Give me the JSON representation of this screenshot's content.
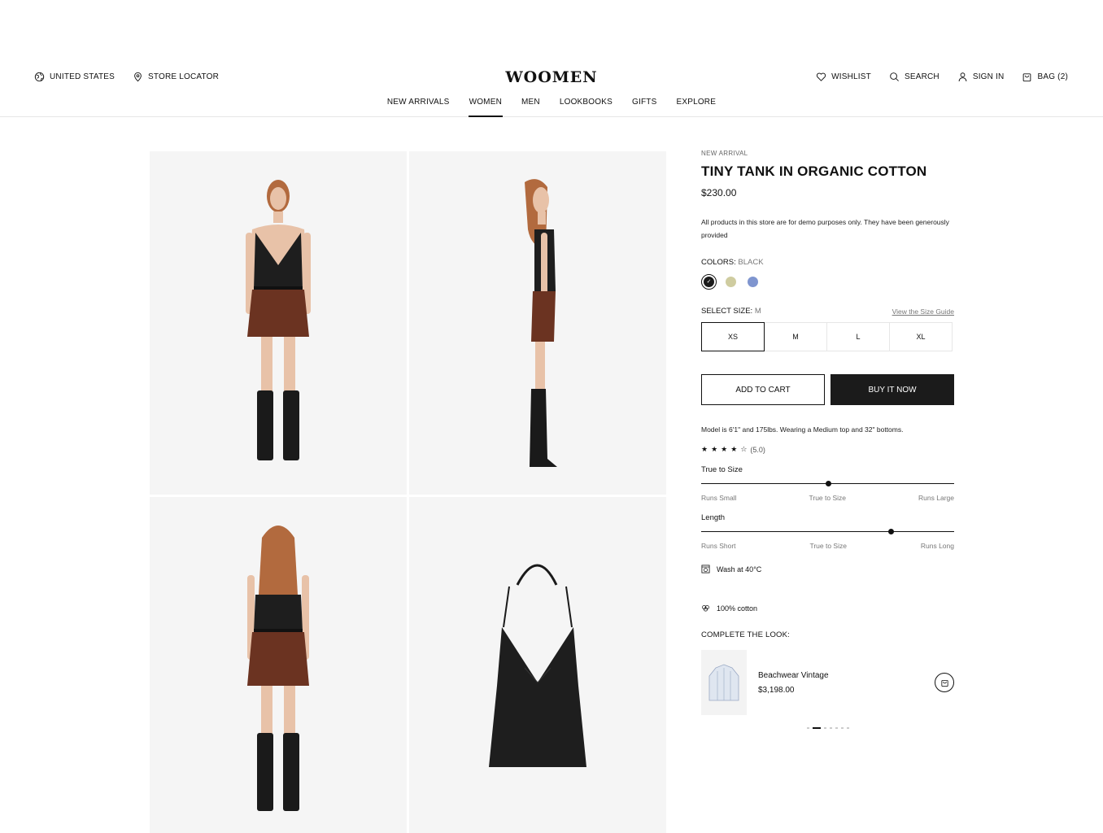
{
  "header": {
    "region": "UNITED STATES",
    "store_locator": "STORE LOCATOR",
    "logo": "WOOMEN",
    "wishlist": "WISHLIST",
    "search": "SEARCH",
    "sign_in": "SIGN IN",
    "bag": "BAG (2)"
  },
  "nav": {
    "items": [
      "NEW ARRIVALS",
      "WOMEN",
      "MEN",
      "LOOKBOOKS",
      "GIFTS",
      "EXPLORE"
    ],
    "active": "WOMEN"
  },
  "product": {
    "eyebrow": "NEW ARRIVAL",
    "title": "TINY TANK IN ORGANIC COTTON",
    "price": "$230.00",
    "note": "All products in this store are for demo purposes only. They have been generously provided",
    "colors_label": "COLORS: ",
    "color_value": "BLACK",
    "colors": [
      "#1a1a1a",
      "#cfcca0",
      "#7f95cf"
    ],
    "size_label": "SELECT SIZE: ",
    "size_value": "M",
    "size_guide": "View the Size Guide",
    "sizes": [
      "XS",
      "M",
      "L",
      "XL"
    ],
    "selected_size_index": 0,
    "add_to_cart": "ADD TO CART",
    "buy_now": "BUY IT NOW",
    "model_note": "Model is 6'1\" and 175lbs. Wearing a Medium top and 32\" bottoms.",
    "rating_text": "(5.0)",
    "stars_filled": 4,
    "stars_total": 5,
    "fit": [
      {
        "label": "True to Size",
        "ticks": [
          "Runs Small",
          "True to Size",
          "Runs Large"
        ],
        "position": 0.5
      },
      {
        "label": "Length",
        "ticks": [
          "Runs Short",
          "True to Size",
          "Runs Long"
        ],
        "position": 0.75
      }
    ],
    "care": "Wash at 40°C",
    "material": "100% cotton",
    "complete_look_title": "COMPLETE THE LOOK:",
    "look_item": {
      "name": "Beachwear Vintage",
      "price": "$3,198.00"
    },
    "carousel_pages": 7,
    "carousel_active": 1
  }
}
